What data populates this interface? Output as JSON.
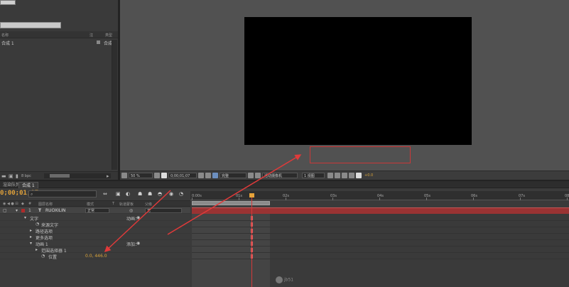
{
  "project": {
    "header_col1": "名称",
    "header_col2": "注",
    "header_col3": "类型",
    "item_name": "合成 1",
    "item_type": "合成",
    "bpc": "8 bpc"
  },
  "viewer": {
    "zoom": "50 %",
    "timecode": "0;00;01;07",
    "resolution": "完整",
    "camera": "活动摄像机",
    "views": "1 视图",
    "exposure": "+0.0"
  },
  "timeline": {
    "tabs": [
      {
        "label": "渲染队列"
      },
      {
        "label": "合成 1"
      }
    ],
    "timecode": "0;00;01;07",
    "headers": {
      "name": "图层名称",
      "mode": "模式",
      "t": "T",
      "trkmat": "轨道蒙板",
      "parent": "父级"
    },
    "layer": {
      "number": "1",
      "name": "RUOXILIN",
      "mode": "正常",
      "parent": "无"
    },
    "rows": [
      {
        "label": "文字",
        "right": "动画："
      },
      {
        "label": "来源文字"
      },
      {
        "label": "路径选项"
      },
      {
        "label": "更多选项"
      },
      {
        "label": "动画 1",
        "right": "添加："
      },
      {
        "label": "范围选择器 1"
      },
      {
        "label": "位置",
        "value": "0.0, 446.0"
      }
    ],
    "ruler_labels": [
      "0:00s",
      "01s",
      "02s",
      "03s",
      "04s",
      "05s",
      "06s",
      "07s",
      "08s"
    ],
    "watermark": "jb51"
  },
  "colors": {
    "accent_orange": "#e0a13a",
    "annotation_red": "#e03a3a",
    "layer_bar": "#9a3333"
  }
}
